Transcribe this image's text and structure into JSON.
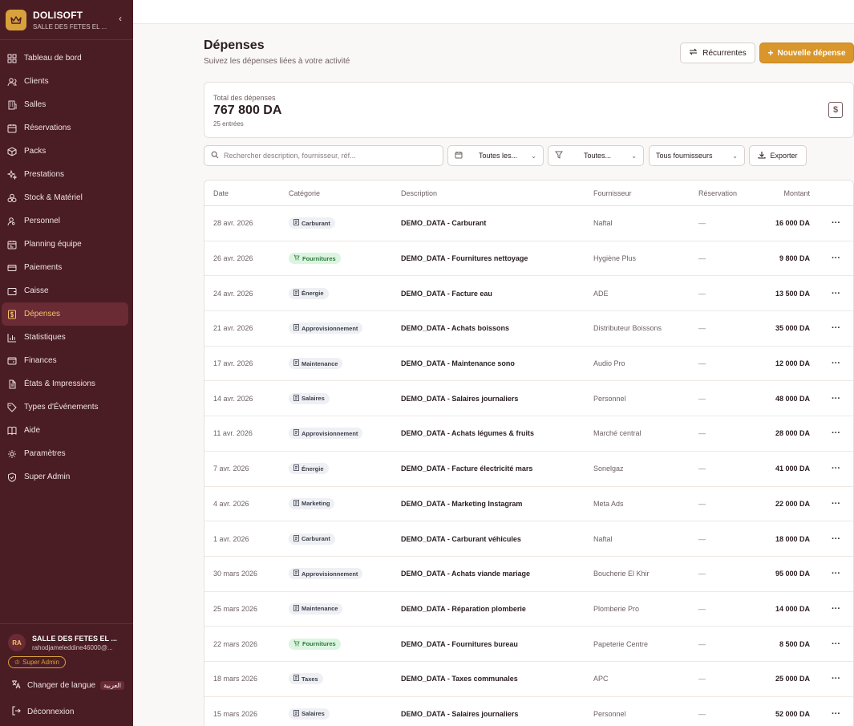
{
  "brand": {
    "name": "DOLISOFT",
    "subtitle": "SALLE DES FETES EL ..."
  },
  "nav": [
    {
      "label": "Tableau de bord",
      "icon": "dashboard-icon"
    },
    {
      "label": "Clients",
      "icon": "users-icon"
    },
    {
      "label": "Salles",
      "icon": "building-icon"
    },
    {
      "label": "Réservations",
      "icon": "calendar-icon"
    },
    {
      "label": "Packs",
      "icon": "package-icon"
    },
    {
      "label": "Prestations",
      "icon": "sparkles-icon"
    },
    {
      "label": "Stock & Matériel",
      "icon": "boxes-icon"
    },
    {
      "label": "Personnel",
      "icon": "user-cog-icon"
    },
    {
      "label": "Planning équipe",
      "icon": "calendar-team-icon"
    },
    {
      "label": "Paiements",
      "icon": "credit-card-icon"
    },
    {
      "label": "Caisse",
      "icon": "wallet-icon"
    },
    {
      "label": "Dépenses",
      "icon": "dollar-square-icon",
      "active": true
    },
    {
      "label": "Statistiques",
      "icon": "bar-chart-icon"
    },
    {
      "label": "Finances",
      "icon": "finance-icon"
    },
    {
      "label": "États & Impressions",
      "icon": "file-text-icon"
    },
    {
      "label": "Types d'Événements",
      "icon": "tag-icon"
    },
    {
      "label": "Aide",
      "icon": "book-icon"
    },
    {
      "label": "Paramètres",
      "icon": "settings-icon"
    },
    {
      "label": "Super Admin",
      "icon": "shield-icon"
    }
  ],
  "user": {
    "initials": "RA",
    "name": "SALLE DES FETES EL ...",
    "email": "rahodjameleddine46000@...",
    "role": "Super Admin"
  },
  "footer": {
    "language_label": "Changer de langue",
    "language_badge": "العربية",
    "logout_label": "Déconnexion"
  },
  "header": {
    "title": "Dépenses",
    "subtitle": "Suivez les dépenses liées à votre activité",
    "recurring_label": "Récurrentes",
    "new_label": "Nouvelle dépense"
  },
  "summary": {
    "label": "Total des dépenses",
    "total": "767 800 DA",
    "count": "25 entrées"
  },
  "filters": {
    "search_placeholder": "Rechercher description, fournisseur, réf...",
    "dates": "Toutes les...",
    "categories": "Toutes...",
    "suppliers": "Tous fournisseurs",
    "export_label": "Exporter"
  },
  "table": {
    "columns": {
      "date": "Date",
      "category": "Catégorie",
      "description": "Description",
      "supplier": "Fournisseur",
      "reservation": "Réservation",
      "amount": "Montant"
    },
    "rows": [
      {
        "date": "28 avr. 2026",
        "category": "Carburant",
        "cat_style": "default",
        "description": "DEMO_DATA - Carburant",
        "supplier": "Naftal",
        "reservation": "—",
        "amount": "16 000 DA"
      },
      {
        "date": "26 avr. 2026",
        "category": "Fournitures",
        "cat_style": "green",
        "description": "DEMO_DATA - Fournitures nettoyage",
        "supplier": "Hygiène Plus",
        "reservation": "—",
        "amount": "9 800 DA"
      },
      {
        "date": "24 avr. 2026",
        "category": "Énergie",
        "cat_style": "default",
        "description": "DEMO_DATA - Facture eau",
        "supplier": "ADE",
        "reservation": "—",
        "amount": "13 500 DA"
      },
      {
        "date": "21 avr. 2026",
        "category": "Approvisionnement",
        "cat_style": "default",
        "description": "DEMO_DATA - Achats boissons",
        "supplier": "Distributeur Boissons",
        "reservation": "—",
        "amount": "35 000 DA"
      },
      {
        "date": "17 avr. 2026",
        "category": "Maintenance",
        "cat_style": "default",
        "description": "DEMO_DATA - Maintenance sono",
        "supplier": "Audio Pro",
        "reservation": "—",
        "amount": "12 000 DA"
      },
      {
        "date": "14 avr. 2026",
        "category": "Salaires",
        "cat_style": "default",
        "description": "DEMO_DATA - Salaires journaliers",
        "supplier": "Personnel",
        "reservation": "—",
        "amount": "48 000 DA"
      },
      {
        "date": "11 avr. 2026",
        "category": "Approvisionnement",
        "cat_style": "default",
        "description": "DEMO_DATA - Achats légumes & fruits",
        "supplier": "Marché central",
        "reservation": "—",
        "amount": "28 000 DA"
      },
      {
        "date": "7 avr. 2026",
        "category": "Énergie",
        "cat_style": "default",
        "description": "DEMO_DATA - Facture électricité mars",
        "supplier": "Sonelgaz",
        "reservation": "—",
        "amount": "41 000 DA"
      },
      {
        "date": "4 avr. 2026",
        "category": "Marketing",
        "cat_style": "default",
        "description": "DEMO_DATA - Marketing Instagram",
        "supplier": "Meta Ads",
        "reservation": "—",
        "amount": "22 000 DA"
      },
      {
        "date": "1 avr. 2026",
        "category": "Carburant",
        "cat_style": "default",
        "description": "DEMO_DATA - Carburant véhicules",
        "supplier": "Naftal",
        "reservation": "—",
        "amount": "18 000 DA"
      },
      {
        "date": "30 mars 2026",
        "category": "Approvisionnement",
        "cat_style": "default",
        "description": "DEMO_DATA - Achats viande mariage",
        "supplier": "Boucherie El Khir",
        "reservation": "—",
        "amount": "95 000 DA"
      },
      {
        "date": "25 mars 2026",
        "category": "Maintenance",
        "cat_style": "default",
        "description": "DEMO_DATA - Réparation plomberie",
        "supplier": "Plomberie Pro",
        "reservation": "—",
        "amount": "14 000 DA"
      },
      {
        "date": "22 mars 2026",
        "category": "Fournitures",
        "cat_style": "green",
        "description": "DEMO_DATA - Fournitures bureau",
        "supplier": "Papeterie Centre",
        "reservation": "—",
        "amount": "8 500 DA"
      },
      {
        "date": "18 mars 2026",
        "category": "Taxes",
        "cat_style": "default",
        "description": "DEMO_DATA - Taxes communales",
        "supplier": "APC",
        "reservation": "—",
        "amount": "25 000 DA"
      },
      {
        "date": "15 mars 2026",
        "category": "Salaires",
        "cat_style": "default",
        "description": "DEMO_DATA - Salaires journaliers",
        "supplier": "Personnel",
        "reservation": "—",
        "amount": "52 000 DA"
      }
    ],
    "row_action": "···"
  }
}
